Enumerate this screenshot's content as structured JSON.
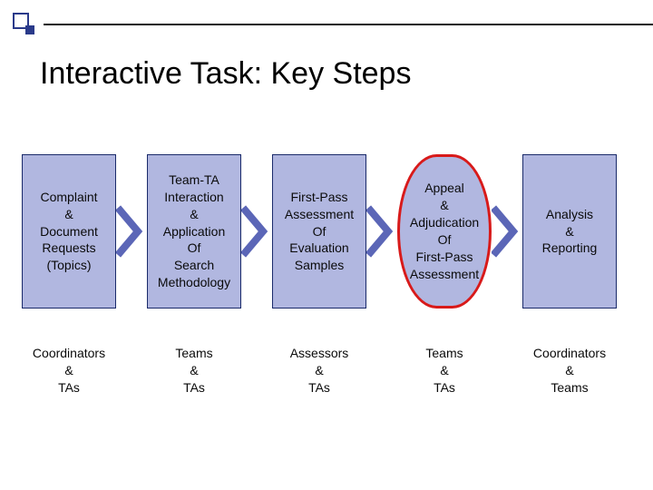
{
  "title": "Interactive Task: Key Steps",
  "steps": [
    {
      "box": "Complaint\n&\nDocument\nRequests\n(Topics)",
      "label": "Coordinators\n&\nTAs",
      "highlight": false
    },
    {
      "box": "Team-TA\nInteraction\n&\nApplication\nOf\nSearch\nMethodology",
      "label": "Teams\n&\nTAs",
      "highlight": false
    },
    {
      "box": "First-Pass\nAssessment\nOf\nEvaluation\nSamples",
      "label": "Assessors\n&\nTAs",
      "highlight": false
    },
    {
      "box": "Appeal\n&\nAdjudication\nOf\nFirst-Pass\nAssessment",
      "label": "Teams\n&\nTAs",
      "highlight": true
    },
    {
      "box": "Analysis\n&\nReporting",
      "label": "Coordinators\n&\nTeams",
      "highlight": false
    }
  ]
}
